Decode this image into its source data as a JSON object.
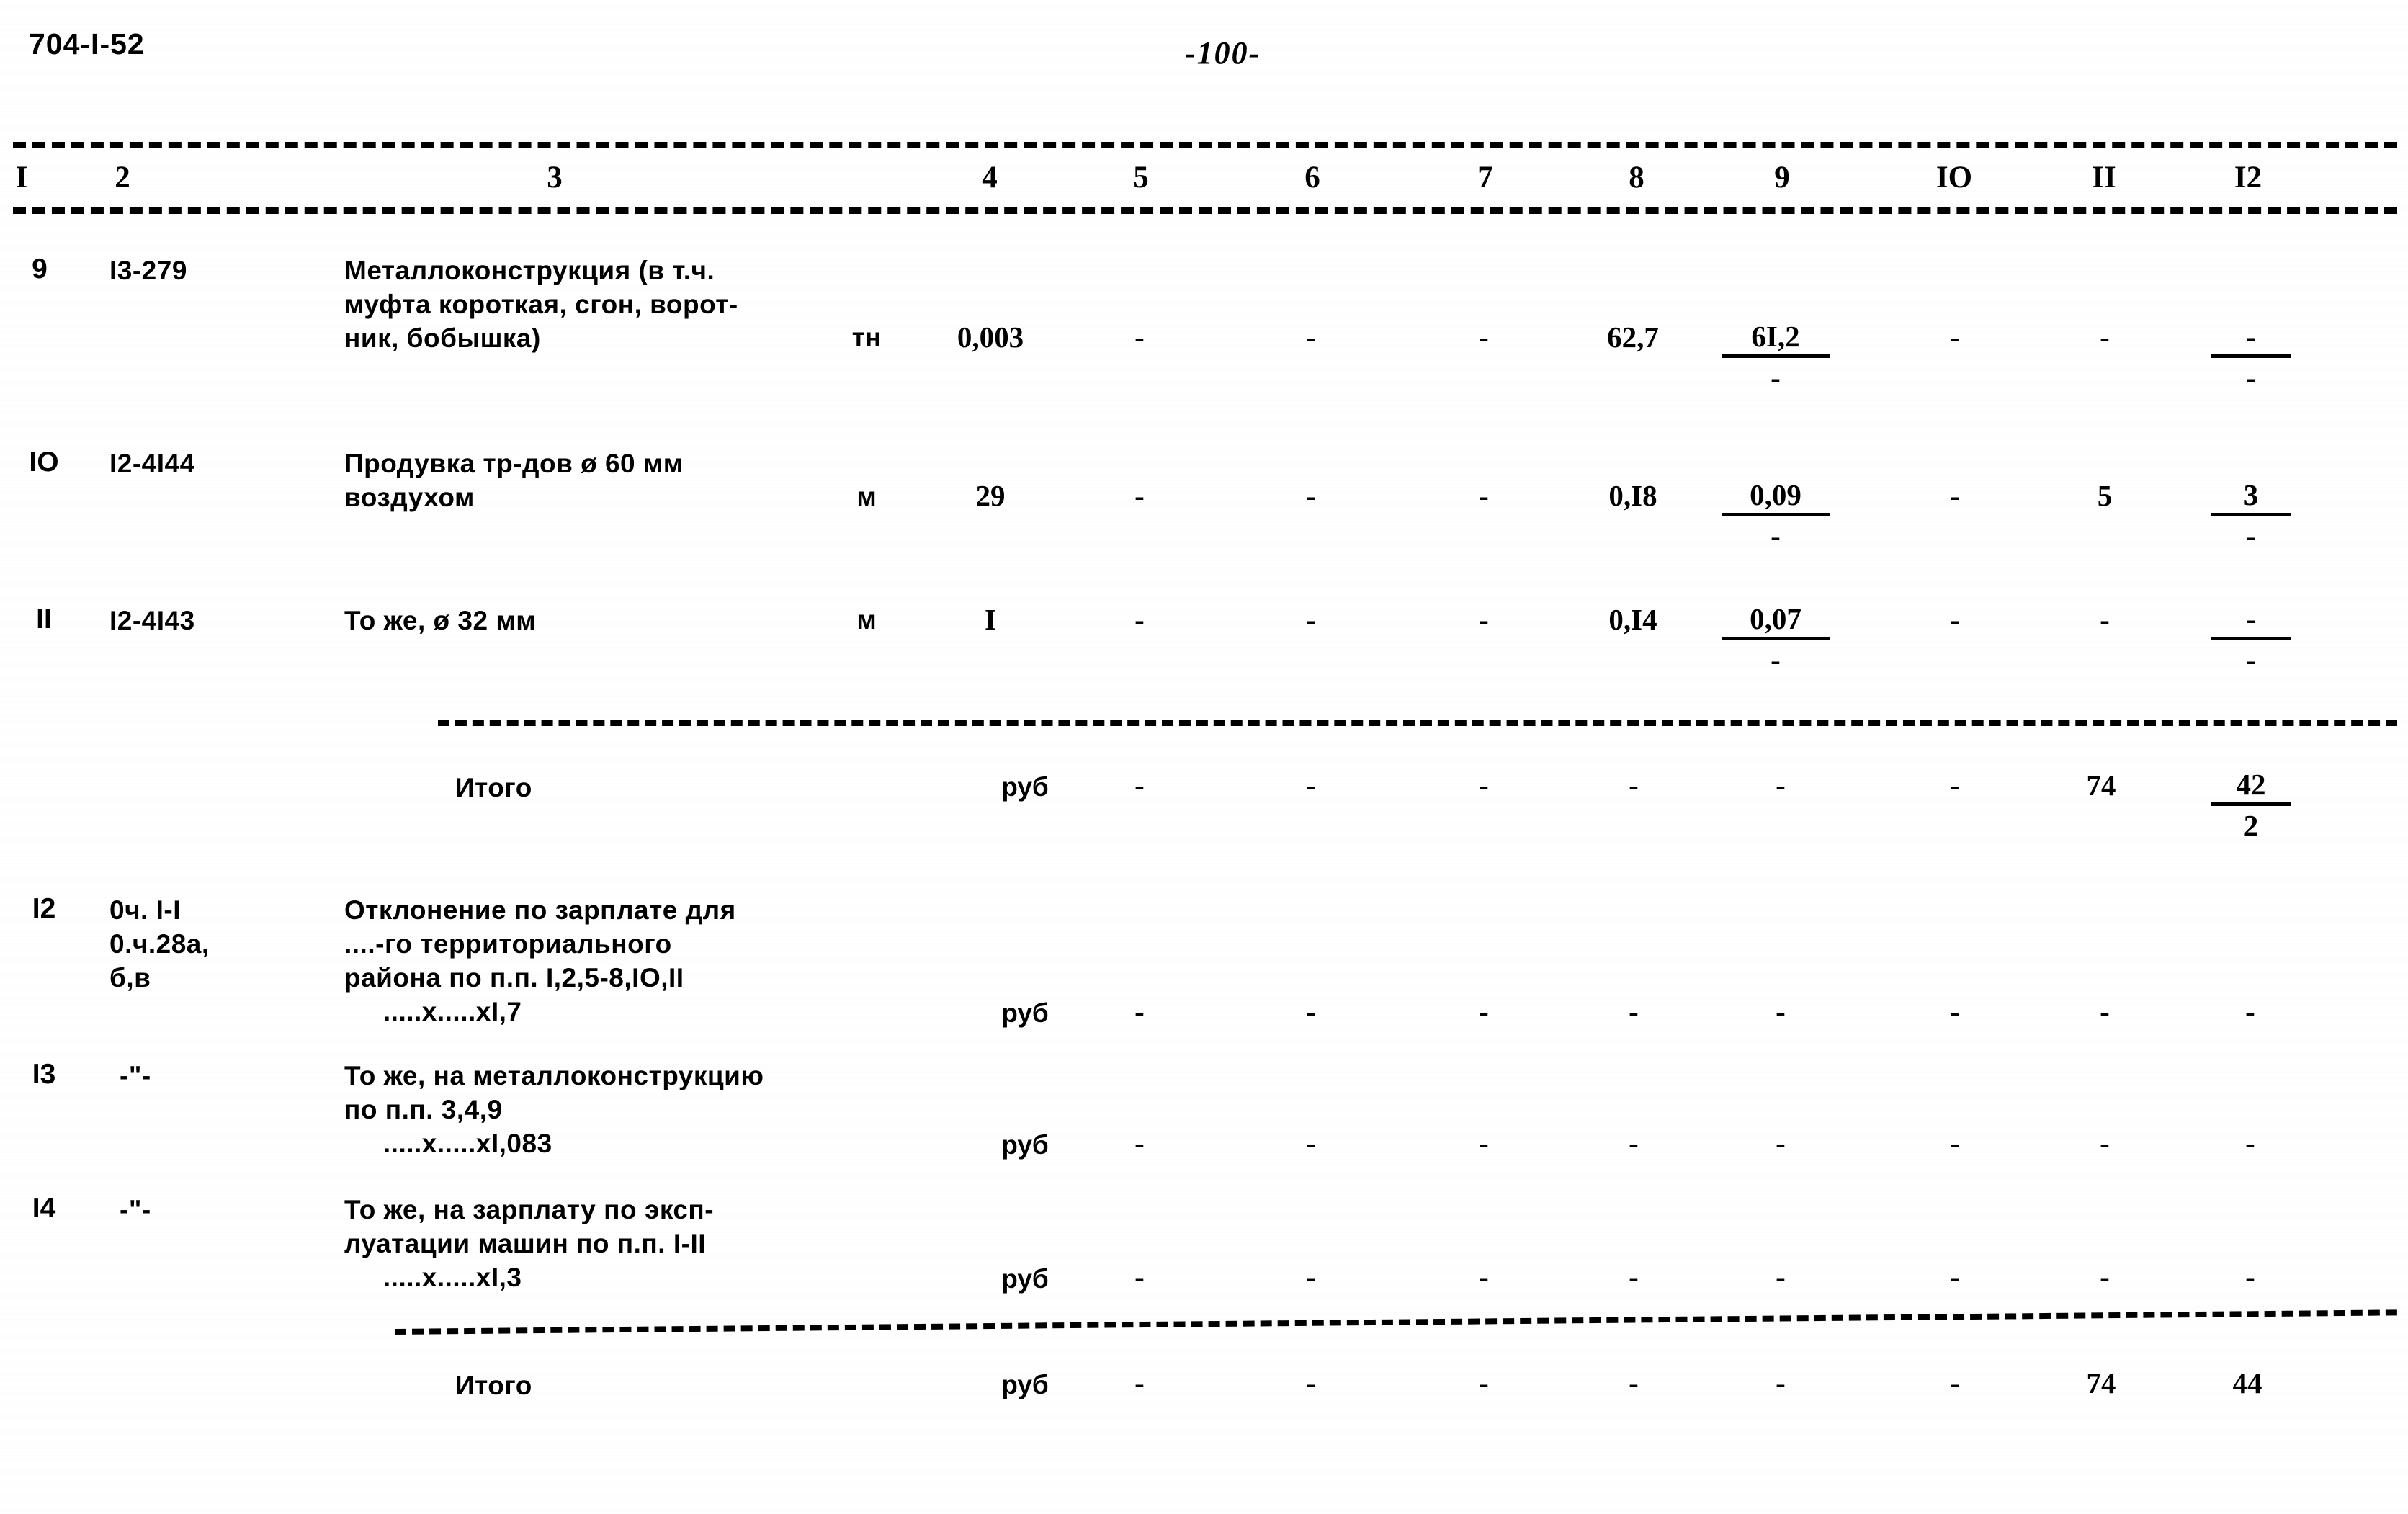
{
  "document": {
    "code": "704-I-52",
    "page_label": "-100-"
  },
  "table": {
    "column_headers": [
      "I",
      "2",
      "3",
      "4",
      "5",
      "6",
      "7",
      "8",
      "9",
      "IO",
      "II",
      "I2"
    ],
    "rows": [
      {
        "no": "9",
        "code": "I3-279",
        "description_lines": [
          "Металлоконструкция (в т.ч.",
          "муфта короткая, сгон, ворот-",
          "ник, бобышка)"
        ],
        "unit": "тн",
        "c4": "0,003",
        "c5": "-",
        "c6": "-",
        "c7": "-",
        "c8": "62,7",
        "c9_top": "6I,2",
        "c9_bot": "-",
        "c10": "-",
        "c11": "-",
        "c12_top": "-",
        "c12_bot": "-"
      },
      {
        "no": "IO",
        "code": "I2-4I44",
        "description_lines": [
          "Продувка тр-дов ø 60 мм",
          "воздухом"
        ],
        "unit": "м",
        "c4": "29",
        "c5": "-",
        "c6": "-",
        "c7": "-",
        "c8": "0,I8",
        "c9_top": "0,09",
        "c9_bot": "-",
        "c10": "-",
        "c11": "5",
        "c12_top": "3",
        "c12_bot": "-"
      },
      {
        "no": "II",
        "code": "I2-4I43",
        "description_lines": [
          "То же, ø 32 мм"
        ],
        "unit": "м",
        "c4": "I",
        "c5": "-",
        "c6": "-",
        "c7": "-",
        "c8": "0,I4",
        "c9_top": "0,07",
        "c9_bot": "-",
        "c10": "-",
        "c11": "-",
        "c12_top": "-",
        "c12_bot": "-"
      }
    ],
    "subtotal_1": {
      "label": "Итого",
      "unit": "руб",
      "c5": "-",
      "c6": "-",
      "c7": "-",
      "c8": "-",
      "c9": "-",
      "c10": "-",
      "c11": "74",
      "c12_top": "42",
      "c12_bot": "2"
    },
    "adjustment_rows": [
      {
        "no": "I2",
        "code_lines": [
          "0ч. I-I",
          "0.ч.28а,",
          "б,в"
        ],
        "description_lines": [
          "Отклонение по зарплате для",
          "....-го территориального",
          "района по п.п. I,2,5-8,IO,II",
          "     .....х.....хI,7"
        ],
        "unit": "руб",
        "c5": "-",
        "c6": "-",
        "c7": "-",
        "c8": "-",
        "c9": "-",
        "c10": "-",
        "c11": "-",
        "c12": "-"
      },
      {
        "no": "I3",
        "code_lines": [
          "-\"-"
        ],
        "description_lines": [
          "То же, на металлоконструкцию",
          "по п.п. 3,4,9",
          "     .....х.....хI,083"
        ],
        "unit": "руб",
        "c5": "-",
        "c6": "-",
        "c7": "-",
        "c8": "-",
        "c9": "-",
        "c10": "-",
        "c11": "-",
        "c12": "-"
      },
      {
        "no": "I4",
        "code_lines": [
          "-\"-"
        ],
        "description_lines": [
          "То же, на зарплату по эксп-",
          "луатации машин по п.п. I-II",
          "     .....х.....хI,3"
        ],
        "unit": "руб",
        "c5": "-",
        "c6": "-",
        "c7": "-",
        "c8": "-",
        "c9": "-",
        "c10": "-",
        "c11": "-",
        "c12": "-"
      }
    ],
    "subtotal_2": {
      "label": "Итого",
      "unit": "руб",
      "c5": "-",
      "c6": "-",
      "c7": "-",
      "c8": "-",
      "c9": "-",
      "c10": "-",
      "c11": "74",
      "c12": "44"
    }
  }
}
